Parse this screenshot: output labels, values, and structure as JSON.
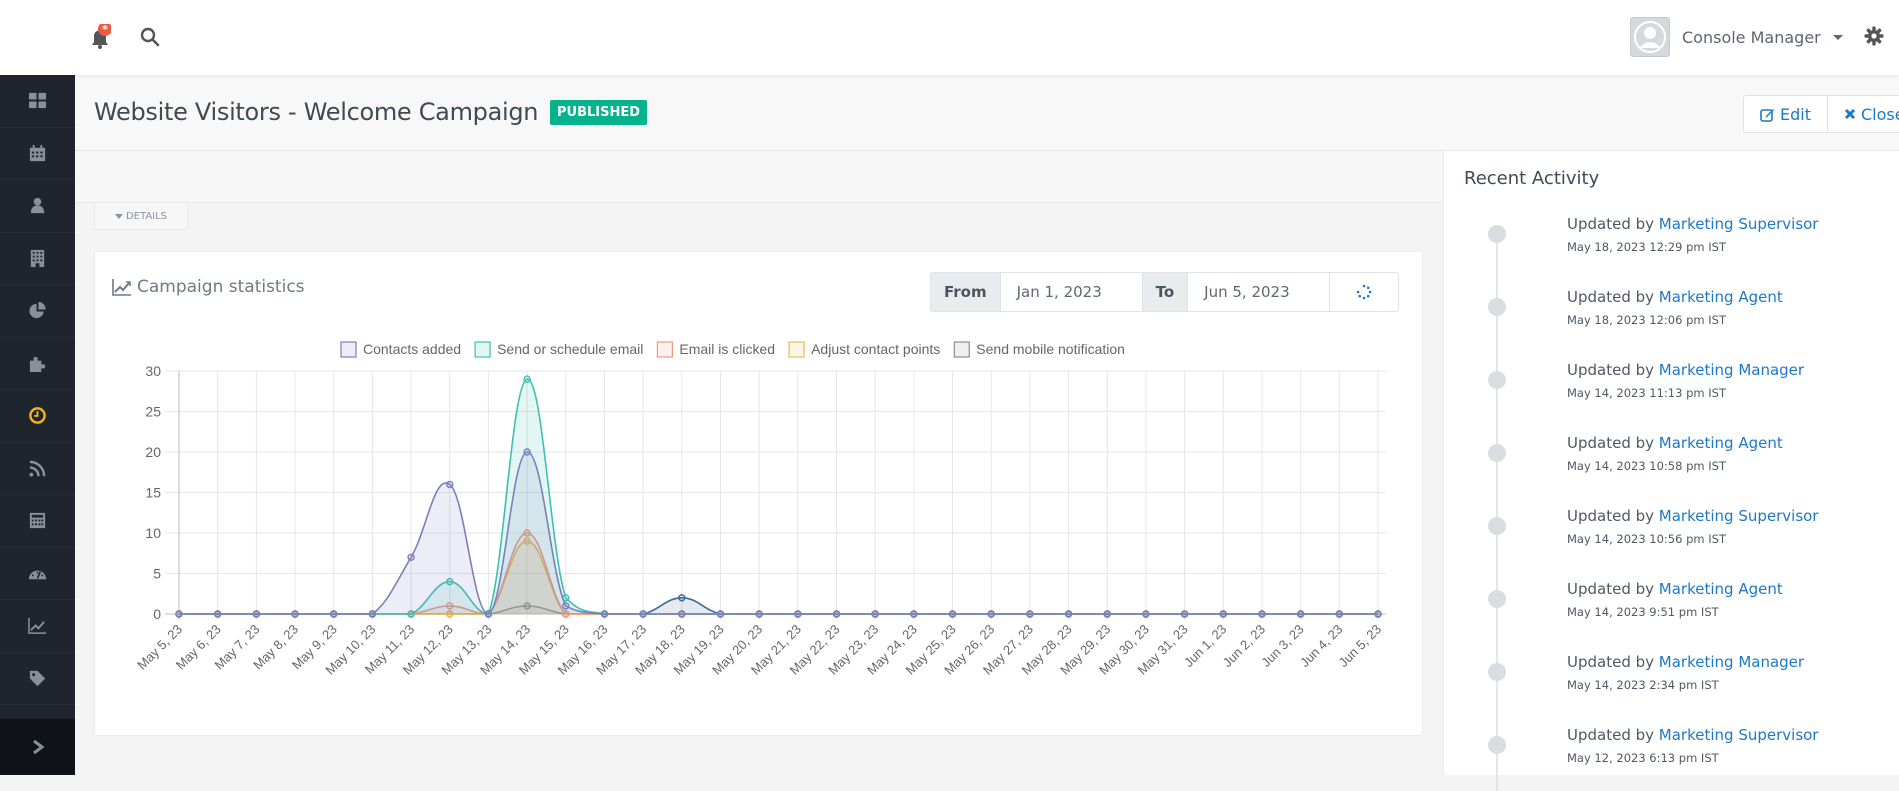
{
  "topbar": {
    "notification_icon": "bell-icon",
    "search_icon": "search-icon",
    "user_name": "Console Manager",
    "settings_icon": "gear-icon"
  },
  "sidebar": {
    "items": [
      {
        "icon": "dashboard-icon",
        "active": false
      },
      {
        "icon": "calendar-icon",
        "active": false
      },
      {
        "icon": "user-icon",
        "active": false
      },
      {
        "icon": "building-icon",
        "active": false
      },
      {
        "icon": "pie-chart-icon",
        "active": false
      },
      {
        "icon": "puzzle-icon",
        "active": false
      },
      {
        "icon": "clock-icon",
        "active": true
      },
      {
        "icon": "rss-icon",
        "active": false
      },
      {
        "icon": "calculator-icon",
        "active": false
      },
      {
        "icon": "dashboard-gauge-icon",
        "active": false
      },
      {
        "icon": "line-chart-icon",
        "active": false
      },
      {
        "icon": "tag-icon",
        "active": false
      }
    ],
    "toggle_icon": "chevron-right-icon",
    "active_color": "#f6b21a"
  },
  "header": {
    "title": "Website Visitors - Welcome Campaign",
    "status": "PUBLISHED",
    "status_color": "#04b28e",
    "edit_label": "Edit",
    "close_label": "Close"
  },
  "details_toggle": "DETAILS",
  "stats": {
    "title": "Campaign statistics",
    "from_label": "From",
    "from_value": "Jan 1, 2023",
    "to_label": "To",
    "to_value": "Jun 5, 2023"
  },
  "chart_data": {
    "type": "line",
    "title": "Campaign statistics",
    "xlabel": "",
    "ylabel": "",
    "ylim": [
      0,
      30
    ],
    "yticks": [
      0,
      5,
      10,
      15,
      20,
      25,
      30
    ],
    "grid": true,
    "legend_position": "top",
    "x": [
      "May 5, 23",
      "May 6, 23",
      "May 7, 23",
      "May 8, 23",
      "May 9, 23",
      "May 10, 23",
      "May 11, 23",
      "May 12, 23",
      "May 13, 23",
      "May 14, 23",
      "May 15, 23",
      "May 16, 23",
      "May 17, 23",
      "May 18, 23",
      "May 19, 23",
      "May 20, 23",
      "May 21, 23",
      "May 22, 23",
      "May 23, 23",
      "May 24, 23",
      "May 25, 23",
      "May 26, 23",
      "May 27, 23",
      "May 28, 23",
      "May 29, 23",
      "May 30, 23",
      "May 31, 23",
      "Jun 1, 23",
      "Jun 2, 23",
      "Jun 3, 23",
      "Jun 4, 23",
      "Jun 5, 23"
    ],
    "series": [
      {
        "name": "Contacts added",
        "color": "#7a7fbd",
        "fill": "rgba(122,127,189,0.14)",
        "in_legend": true,
        "values": [
          0,
          0,
          0,
          0,
          0,
          0,
          7,
          16,
          0,
          20,
          1,
          0,
          0,
          0,
          0,
          0,
          0,
          0,
          0,
          0,
          0,
          0,
          0,
          0,
          0,
          0,
          0,
          0,
          0,
          0,
          0,
          0
        ]
      },
      {
        "name": "Send or schedule email",
        "color": "#3ec1b0",
        "fill": "rgba(62,193,176,0.14)",
        "in_legend": true,
        "values": [
          0,
          0,
          0,
          0,
          0,
          0,
          0,
          4,
          0,
          29,
          2,
          0,
          0,
          0,
          0,
          0,
          0,
          0,
          0,
          0,
          0,
          0,
          0,
          0,
          0,
          0,
          0,
          0,
          0,
          0,
          0,
          0
        ]
      },
      {
        "name": "Email is clicked",
        "color": "#ef9a80",
        "fill": "rgba(239,154,128,0.14)",
        "in_legend": true,
        "values": [
          0,
          0,
          0,
          0,
          0,
          0,
          0,
          1,
          0,
          10,
          0,
          0,
          0,
          0,
          0,
          0,
          0,
          0,
          0,
          0,
          0,
          0,
          0,
          0,
          0,
          0,
          0,
          0,
          0,
          0,
          0,
          0
        ]
      },
      {
        "name": "Adjust contact points",
        "color": "#efb950",
        "fill": "rgba(239,185,80,0.14)",
        "in_legend": true,
        "values": [
          0,
          0,
          0,
          0,
          0,
          0,
          0,
          0,
          0,
          9,
          0,
          0,
          0,
          0,
          0,
          0,
          0,
          0,
          0,
          0,
          0,
          0,
          0,
          0,
          0,
          0,
          0,
          0,
          0,
          0,
          0,
          0
        ]
      },
      {
        "name": "Send mobile notification",
        "color": "#8e8e8e",
        "fill": "rgba(142,142,142,0.14)",
        "in_legend": true,
        "values": [
          0,
          0,
          0,
          0,
          0,
          0,
          0,
          0,
          0,
          1,
          0,
          0,
          0,
          0,
          0,
          0,
          0,
          0,
          0,
          0,
          0,
          0,
          0,
          0,
          0,
          0,
          0,
          0,
          0,
          0,
          0,
          0
        ]
      },
      {
        "name": "",
        "color": "#3d6b94",
        "fill": "rgba(61,107,148,0.14)",
        "in_legend": false,
        "values": [
          0,
          0,
          0,
          0,
          0,
          0,
          null,
          null,
          0,
          null,
          null,
          0,
          0,
          2,
          0,
          0,
          0,
          0,
          0,
          0,
          0,
          0,
          0,
          0,
          0,
          0,
          0,
          0,
          0,
          0,
          0,
          0
        ]
      }
    ]
  },
  "activity": {
    "title": "Recent Activity",
    "items": [
      {
        "prefix": "Updated by",
        "user": "Marketing Supervisor",
        "time": "May 18, 2023 12:29 pm IST"
      },
      {
        "prefix": "Updated by",
        "user": "Marketing Agent",
        "time": "May 18, 2023 12:06 pm IST"
      },
      {
        "prefix": "Updated by",
        "user": "Marketing Manager",
        "time": "May 14, 2023 11:13 pm IST"
      },
      {
        "prefix": "Updated by",
        "user": "Marketing Agent",
        "time": "May 14, 2023 10:58 pm IST"
      },
      {
        "prefix": "Updated by",
        "user": "Marketing Supervisor",
        "time": "May 14, 2023 10:56 pm IST"
      },
      {
        "prefix": "Updated by",
        "user": "Marketing Agent",
        "time": "May 14, 2023 9:51 pm IST"
      },
      {
        "prefix": "Updated by",
        "user": "Marketing Manager",
        "time": "May 14, 2023 2:34 pm IST"
      },
      {
        "prefix": "Updated by",
        "user": "Marketing Supervisor",
        "time": "May 12, 2023 6:13 pm IST"
      }
    ]
  }
}
